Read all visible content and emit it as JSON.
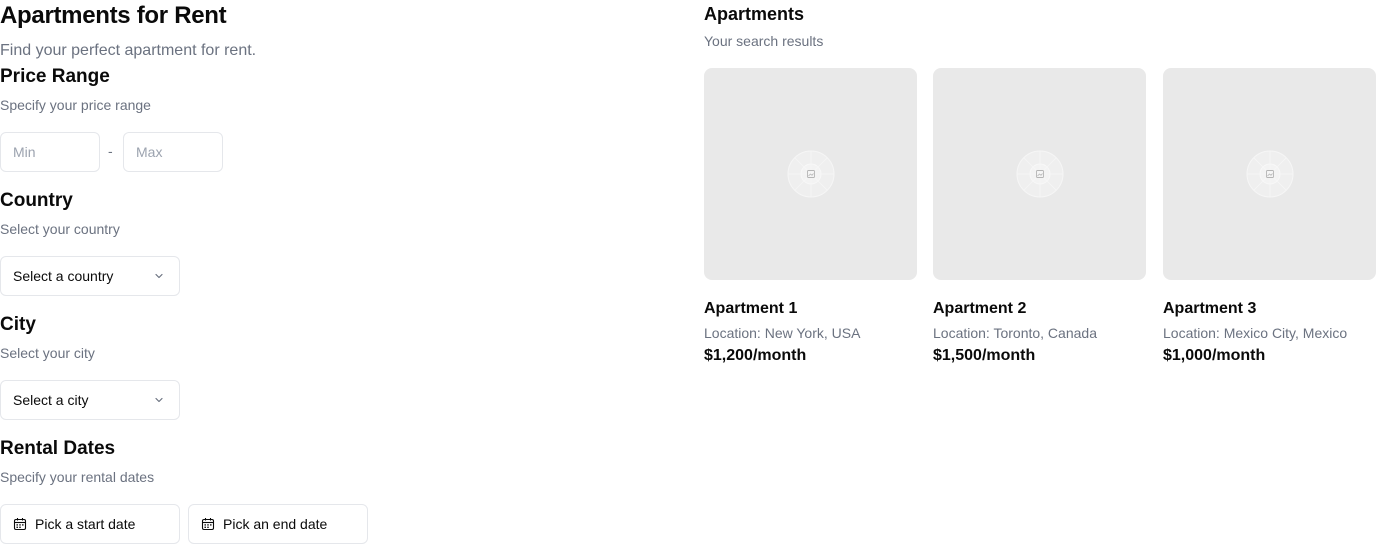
{
  "header": {
    "title": "Apartments for Rent",
    "subtitle": "Find your perfect apartment for rent."
  },
  "price_range": {
    "title": "Price Range",
    "subtitle": "Specify your price range",
    "min_placeholder": "Min",
    "max_placeholder": "Max",
    "separator": "-"
  },
  "country": {
    "title": "Country",
    "subtitle": "Select your country",
    "select_value": "Select a country",
    "icon": "chevron-down-icon"
  },
  "city": {
    "title": "City",
    "subtitle": "Select your city",
    "select_value": "Select a city",
    "icon": "chevron-down-icon"
  },
  "rental_dates": {
    "title": "Rental Dates",
    "subtitle": "Specify your rental dates",
    "start_label": "Pick a start date",
    "end_label": "Pick an end date",
    "icon": "calendar-icon"
  },
  "results": {
    "title": "Apartments",
    "subtitle": "Your search results",
    "apartments": [
      {
        "name": "Apartment 1",
        "location": "Location: New York, USA",
        "price": "$1,200/month"
      },
      {
        "name": "Apartment 2",
        "location": "Location: Toronto, Canada",
        "price": "$1,500/month"
      },
      {
        "name": "Apartment 3",
        "location": "Location: Mexico City, Mexico",
        "price": "$1,000/month"
      }
    ]
  },
  "colors": {
    "muted_text": "#6b7280",
    "border": "#e5e7eb",
    "image_placeholder": "#e9e9e9"
  }
}
